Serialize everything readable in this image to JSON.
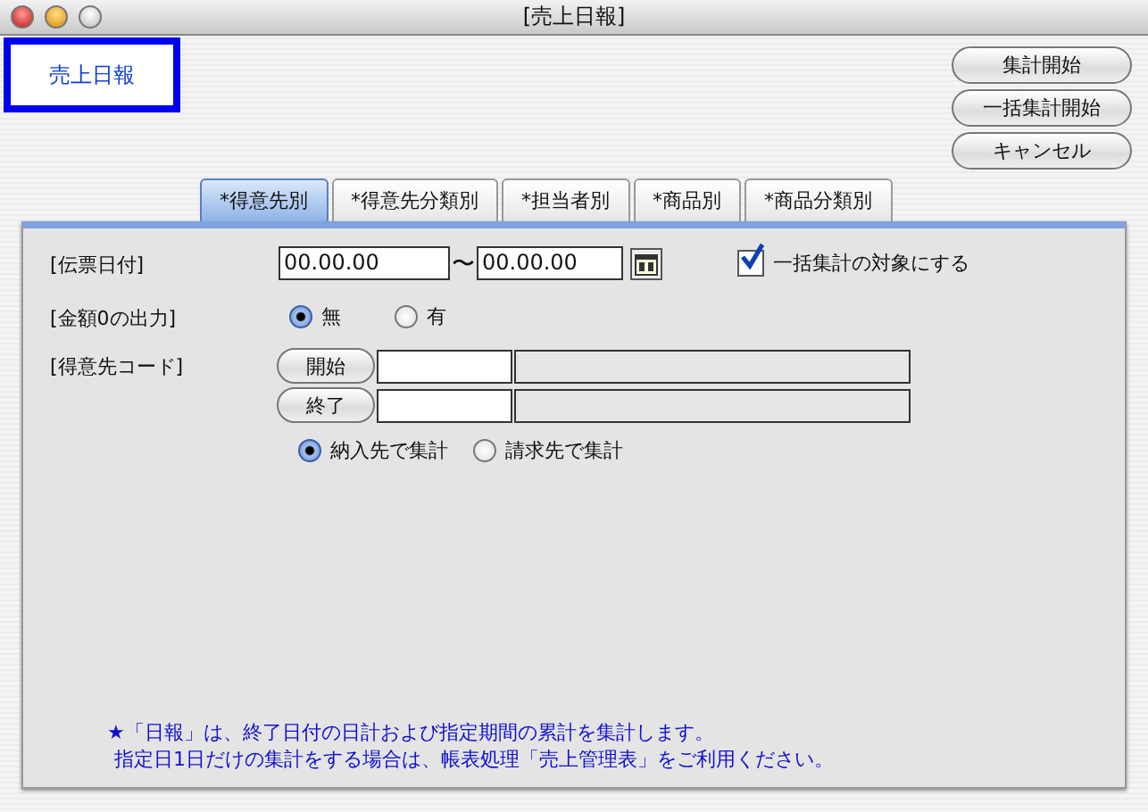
{
  "window": {
    "title": "[売上日報]"
  },
  "report_title": "売上日報",
  "buttons": [
    "集計開始",
    "一括集計開始",
    "キャンセル"
  ],
  "tabs": [
    {
      "label": "*得意先別",
      "selected": true
    },
    {
      "label": "*得意先分類別",
      "selected": false
    },
    {
      "label": "*担当者別",
      "selected": false
    },
    {
      "label": "*商品別",
      "selected": false
    },
    {
      "label": "*商品分類別",
      "selected": false
    }
  ],
  "date": {
    "label": "[伝票日付]",
    "from": "00.00.00",
    "separator": "〜",
    "to": "00.00.00",
    "batch": {
      "label": "一括集計の対象にする",
      "checked": true
    }
  },
  "zero_output": {
    "label": "[金額0の出力]",
    "options": [
      {
        "label": "無",
        "selected": true
      },
      {
        "label": "有",
        "selected": false
      }
    ]
  },
  "customer_code": {
    "label": "[得意先コード]",
    "start_button": "開始",
    "end_button": "終了",
    "aggregate_options": [
      {
        "label": "納入先で集計",
        "selected": true
      },
      {
        "label": "請求先で集計",
        "selected": false
      }
    ]
  },
  "notes": [
    "★「日報」は、終了日付の日計および指定期間の累計を集計します。",
    "指定日1日だけの集計をする場合は、帳表処理「売上管理表」をご利用ください。"
  ]
}
